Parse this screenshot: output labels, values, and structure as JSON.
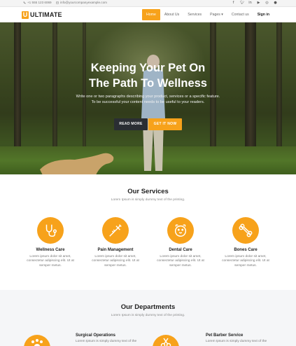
{
  "topbar": {
    "phone": "+1 555 123 6069",
    "email": "info@yourcompanyexample.com",
    "social_icons": [
      "facebook-icon",
      "twitter-icon",
      "linkedin-icon",
      "youtube-icon",
      "instagram-icon",
      "github-icon"
    ]
  },
  "brand": {
    "mark": "U",
    "name": "ULTIMATE"
  },
  "nav": {
    "items": [
      {
        "label": "Home",
        "active": true
      },
      {
        "label": "About Us"
      },
      {
        "label": "Services"
      },
      {
        "label": "Pages ▾"
      },
      {
        "label": "Contact us"
      },
      {
        "label": "Sign in"
      }
    ]
  },
  "hero": {
    "title_line1": "Keeping Your Pet On",
    "title_line2": "The Path To Wellness",
    "sub_line1": "Write one or two paragraphs describing your product, services or a specific feature.",
    "sub_line2": "To be successful your content needs to be useful to your readers.",
    "btn_read_more": "READ MORE",
    "btn_get_it_now": "GET IT NOW"
  },
  "services": {
    "title": "Our Services",
    "subtitle": "Lorem Ipsum is simply dummy text of the printing.",
    "items": [
      {
        "name": "Wellness Care",
        "desc1": "Lorem ipsum dolor sit amet,",
        "desc2": "consectetur adipiscing elit. Ut at",
        "desc3": "semper metus."
      },
      {
        "name": "Pain Management",
        "desc1": "Lorem ipsum dolor sit amet,",
        "desc2": "consectetur adipiscing elit. Ut at",
        "desc3": "semper metus."
      },
      {
        "name": "Dental Care",
        "desc1": "Lorem ipsum dolor sit amet,",
        "desc2": "consectetur adipiscing elit. Ut at",
        "desc3": "semper metus."
      },
      {
        "name": "Bones  Care",
        "desc1": "Lorem ipsum dolor sit amet,",
        "desc2": "consectetur adipiscing elit. Ut at",
        "desc3": "semper metus."
      }
    ]
  },
  "departments": {
    "title": "Our Departments",
    "subtitle": "Lorem Ipsum is simply dummy text of the printing.",
    "items": [
      {
        "name": "Surgical Operations",
        "desc": "Lorem Ipsum is simply dummy text of the"
      },
      {
        "name": "Pet Barber Service",
        "desc": "Lorem Ipsum is simply dummy text of the"
      }
    ]
  },
  "colors": {
    "accent": "#f7a21b",
    "dark": "#2a2e33"
  }
}
